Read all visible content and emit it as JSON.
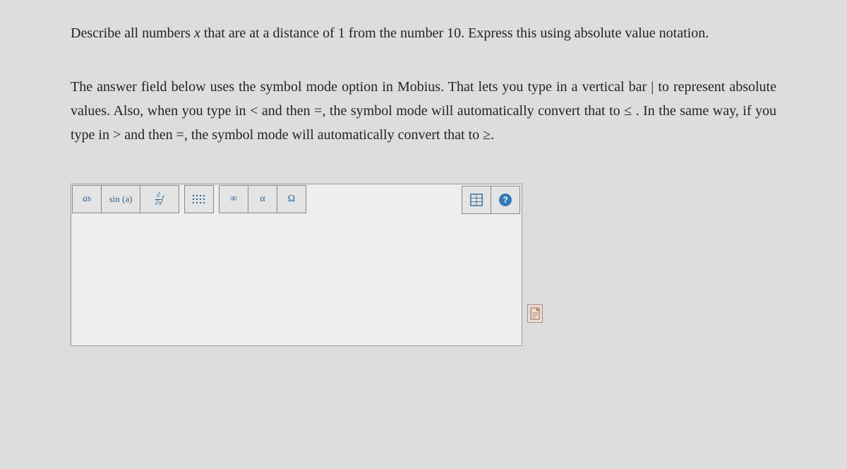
{
  "question": {
    "line1_pre": "Describe all numbers ",
    "var": "x",
    "line1_post": " that are at a distance of 1 from the number 10. Express this using absolute value notation."
  },
  "instructions": {
    "text_pre": "The answer field below uses the symbol mode option in Mobius. That lets you type in a vertical bar | to represent absolute values. Also, when you type in ",
    "sym_lt": "<",
    "text_mid1": " and then ",
    "sym_eq1": "=",
    "text_mid2": ", the symbol mode will automatically convert that to ",
    "sym_le": "≤",
    "text_mid3": " . In the same way, if you type in ",
    "sym_gt": ">",
    "text_mid4": " and then ",
    "sym_eq2": "=",
    "text_mid5": ", the symbol mode will automatically convert that to ",
    "sym_ge": "≥",
    "text_end": "."
  },
  "toolbar": {
    "exp_base": "a",
    "exp_sup": "b",
    "trig": "sin (a)",
    "deriv_top": "∂",
    "deriv_bot": "∂x",
    "deriv_f": "f",
    "infinity": "∞",
    "alpha": "α",
    "omega": "Ω",
    "help": "?"
  }
}
